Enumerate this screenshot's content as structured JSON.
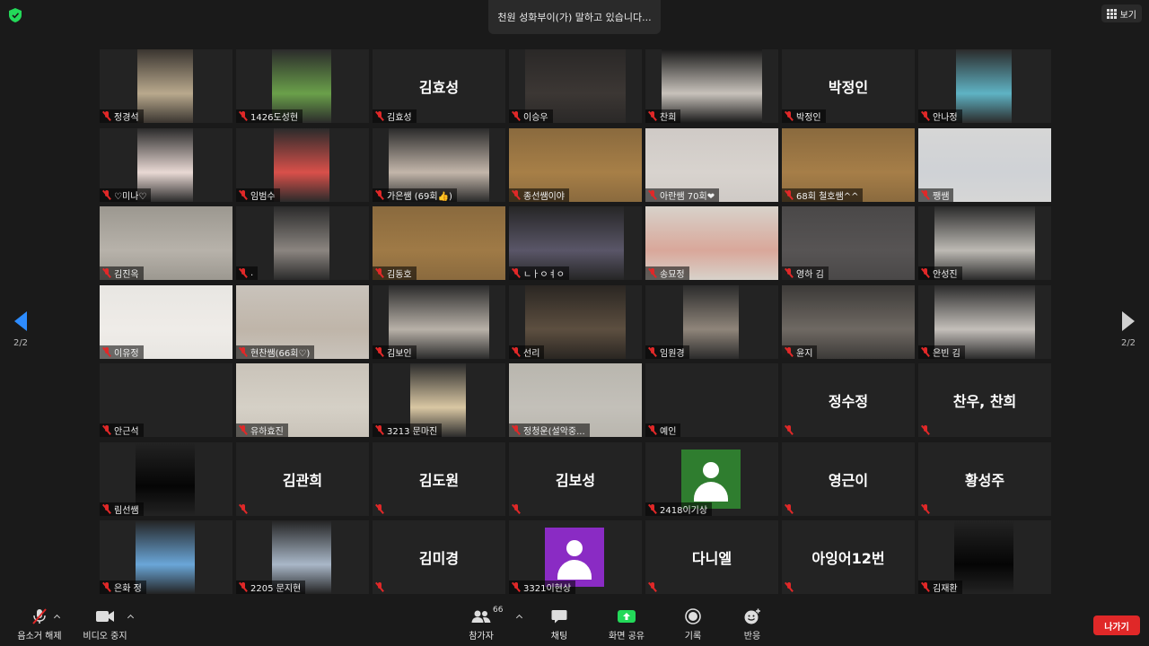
{
  "header": {
    "speaker_banner": "천원 성화부이(가) 말하고 있습니다...",
    "view_button": "보기"
  },
  "navigation": {
    "page_left": "2/2",
    "page_right": "2/2"
  },
  "participants": [
    {
      "name": "정경석",
      "video": true,
      "bg": "#3a3530",
      "x": 42,
      "w": 62,
      "tone": "#b9a98d"
    },
    {
      "name": "1426도성현",
      "video": true,
      "bg": "#2b2b2b",
      "x": 40,
      "w": 66,
      "tone": "#6aa04a"
    },
    {
      "name": "김효성",
      "video": false
    },
    {
      "name": "이승우",
      "video": true,
      "bg": "#2a2827",
      "x": 18,
      "w": 112,
      "tone": "#3c3734"
    },
    {
      "name": "찬희",
      "video": true,
      "bg": "#1a1a1a",
      "x": 18,
      "w": 112,
      "tone": "#c8c2bb"
    },
    {
      "name": "박정인",
      "video": false
    },
    {
      "name": "안나정",
      "video": true,
      "bg": "#2b2b2b",
      "x": 42,
      "w": 62,
      "tone": "#5fb3c4"
    },
    {
      "name": "♡미나♡",
      "video": true,
      "bg": "#2b2b2b",
      "x": 42,
      "w": 62,
      "tone": "#e9d9d4"
    },
    {
      "name": "임범수",
      "video": true,
      "bg": "#2b2b2b",
      "x": 42,
      "w": 62,
      "tone": "#d9504a"
    },
    {
      "name": "가은쌤 (69회👍)",
      "video": true,
      "bg": "#2b2b2b",
      "x": 18,
      "w": 112,
      "tone": "#c3b6aa"
    },
    {
      "name": "종선쌤이야",
      "video": true,
      "bg": "#8a6a3e",
      "x": 0,
      "w": 148,
      "tone": "#a77f47"
    },
    {
      "name": "아란쌤 70회❤",
      "video": true,
      "bg": "#cfcac6",
      "x": 0,
      "w": 148,
      "tone": "#d8d3ce"
    },
    {
      "name": "68회 철호쌤^^",
      "video": true,
      "bg": "#8a6a3e",
      "x": 0,
      "w": 148,
      "tone": "#a67e48"
    },
    {
      "name": "쨍쌤",
      "video": true,
      "bg": "#d6d6d6",
      "x": 0,
      "w": 148,
      "tone": "#cfd2d6"
    },
    {
      "name": "김진옥",
      "video": true,
      "bg": "#9c9890",
      "x": 0,
      "w": 148,
      "tone": "#b7b2aa"
    },
    {
      "name": ".",
      "video": true,
      "bg": "#2b2b2b",
      "x": 42,
      "w": 62,
      "tone": "#8b8580"
    },
    {
      "name": "김동호",
      "video": true,
      "bg": "#8a6a3e",
      "x": 0,
      "w": 148,
      "tone": "#9f7a46"
    },
    {
      "name": "ㄴㅏㅇㅕㅇ",
      "video": true,
      "bg": "#262626",
      "x": 0,
      "w": 128,
      "tone": "#5a5668"
    },
    {
      "name": "송묘정",
      "video": true,
      "bg": "#d8d2ca",
      "x": 0,
      "w": 148,
      "tone": "#d9a79a"
    },
    {
      "name": "영하 김",
      "video": true,
      "bg": "#4a4848",
      "x": 0,
      "w": 148,
      "tone": "#575454"
    },
    {
      "name": "안성진",
      "video": true,
      "bg": "#2b2b2b",
      "x": 18,
      "w": 112,
      "tone": "#bdbab4"
    },
    {
      "name": "이유정",
      "video": true,
      "bg": "#e8e6e2",
      "x": 0,
      "w": 148,
      "tone": "#efece8"
    },
    {
      "name": "현찬쌤(66회♡)",
      "video": true,
      "bg": "#c9c3bb",
      "x": 0,
      "w": 148,
      "tone": "#bfb5a9"
    },
    {
      "name": "김보인",
      "video": true,
      "bg": "#2b2b2b",
      "x": 18,
      "w": 112,
      "tone": "#b8b1a8"
    },
    {
      "name": "선리",
      "video": true,
      "bg": "#2a2622",
      "x": 18,
      "w": 112,
      "tone": "#5d4f40"
    },
    {
      "name": "임원경",
      "video": true,
      "bg": "#2b2b2b",
      "x": 42,
      "w": 62,
      "tone": "#8f857a"
    },
    {
      "name": "윤지",
      "video": true,
      "bg": "#3c3a38",
      "x": 0,
      "w": 148,
      "tone": "#6f6963"
    },
    {
      "name": "은빈 김",
      "video": true,
      "bg": "#2b2b2b",
      "x": 18,
      "w": 112,
      "tone": "#c4bfba"
    },
    {
      "name": "안근석",
      "video": false,
      "noname": true
    },
    {
      "name": "유하효진",
      "video": true,
      "bg": "#c9c3b9",
      "x": 0,
      "w": 148,
      "tone": "#d5d0c6"
    },
    {
      "name": "3213 문마진",
      "video": true,
      "bg": "#2b2b2b",
      "x": 42,
      "w": 62,
      "tone": "#d9c7a3"
    },
    {
      "name": "정청운(설악중...",
      "video": true,
      "bg": "#b9b6ae",
      "x": 0,
      "w": 148,
      "tone": "#c3c0b9"
    },
    {
      "name": "예인",
      "video": false,
      "noname": true
    },
    {
      "name": "정수정",
      "video": false,
      "tagEmpty": true
    },
    {
      "name": "찬우, 찬희",
      "video": false,
      "tagEmpty": true
    },
    {
      "name": "림선쌤",
      "video": true,
      "bg": "#232323",
      "x": 40,
      "w": 66,
      "tone": "#050505"
    },
    {
      "name": "김관희",
      "video": false,
      "tagEmpty": true
    },
    {
      "name": "김도원",
      "video": false,
      "tagEmpty": true
    },
    {
      "name": "김보성",
      "video": false,
      "tagEmpty": true
    },
    {
      "name": "2418이기상",
      "video": false,
      "avatar": "green"
    },
    {
      "name": "영근이",
      "video": false,
      "tagEmpty": true
    },
    {
      "name": "황성주",
      "video": false,
      "tagEmpty": true
    },
    {
      "name": "은화 정",
      "video": true,
      "bg": "#232323",
      "x": 40,
      "w": 66,
      "tone": "#6aa6d8"
    },
    {
      "name": "2205 문지현",
      "video": true,
      "bg": "#232323",
      "x": 40,
      "w": 66,
      "tone": "#a9b7c8"
    },
    {
      "name": "김미경",
      "video": false,
      "tagEmpty": true
    },
    {
      "name": "3321이현상",
      "video": false,
      "avatar": "purple"
    },
    {
      "name": "다니엘",
      "video": false,
      "tagEmpty": true
    },
    {
      "name": "아잉어12번",
      "video": false,
      "tagEmpty": true
    },
    {
      "name": "김재환",
      "video": true,
      "bg": "#232323",
      "x": 40,
      "w": 66,
      "tone": "#050505"
    }
  ],
  "toolbar": {
    "unmute": "음소거 해제",
    "stop_video": "비디오 중지",
    "participants": "참가자",
    "participants_count": "66",
    "chat": "채팅",
    "share_screen": "화면 공유",
    "record": "기록",
    "reactions": "반응",
    "leave": "나가기"
  },
  "colors": {
    "accent_blue": "#2d8cff",
    "share_green": "#23d959",
    "leave_red": "#e02828",
    "muted_red": "#e02828"
  }
}
